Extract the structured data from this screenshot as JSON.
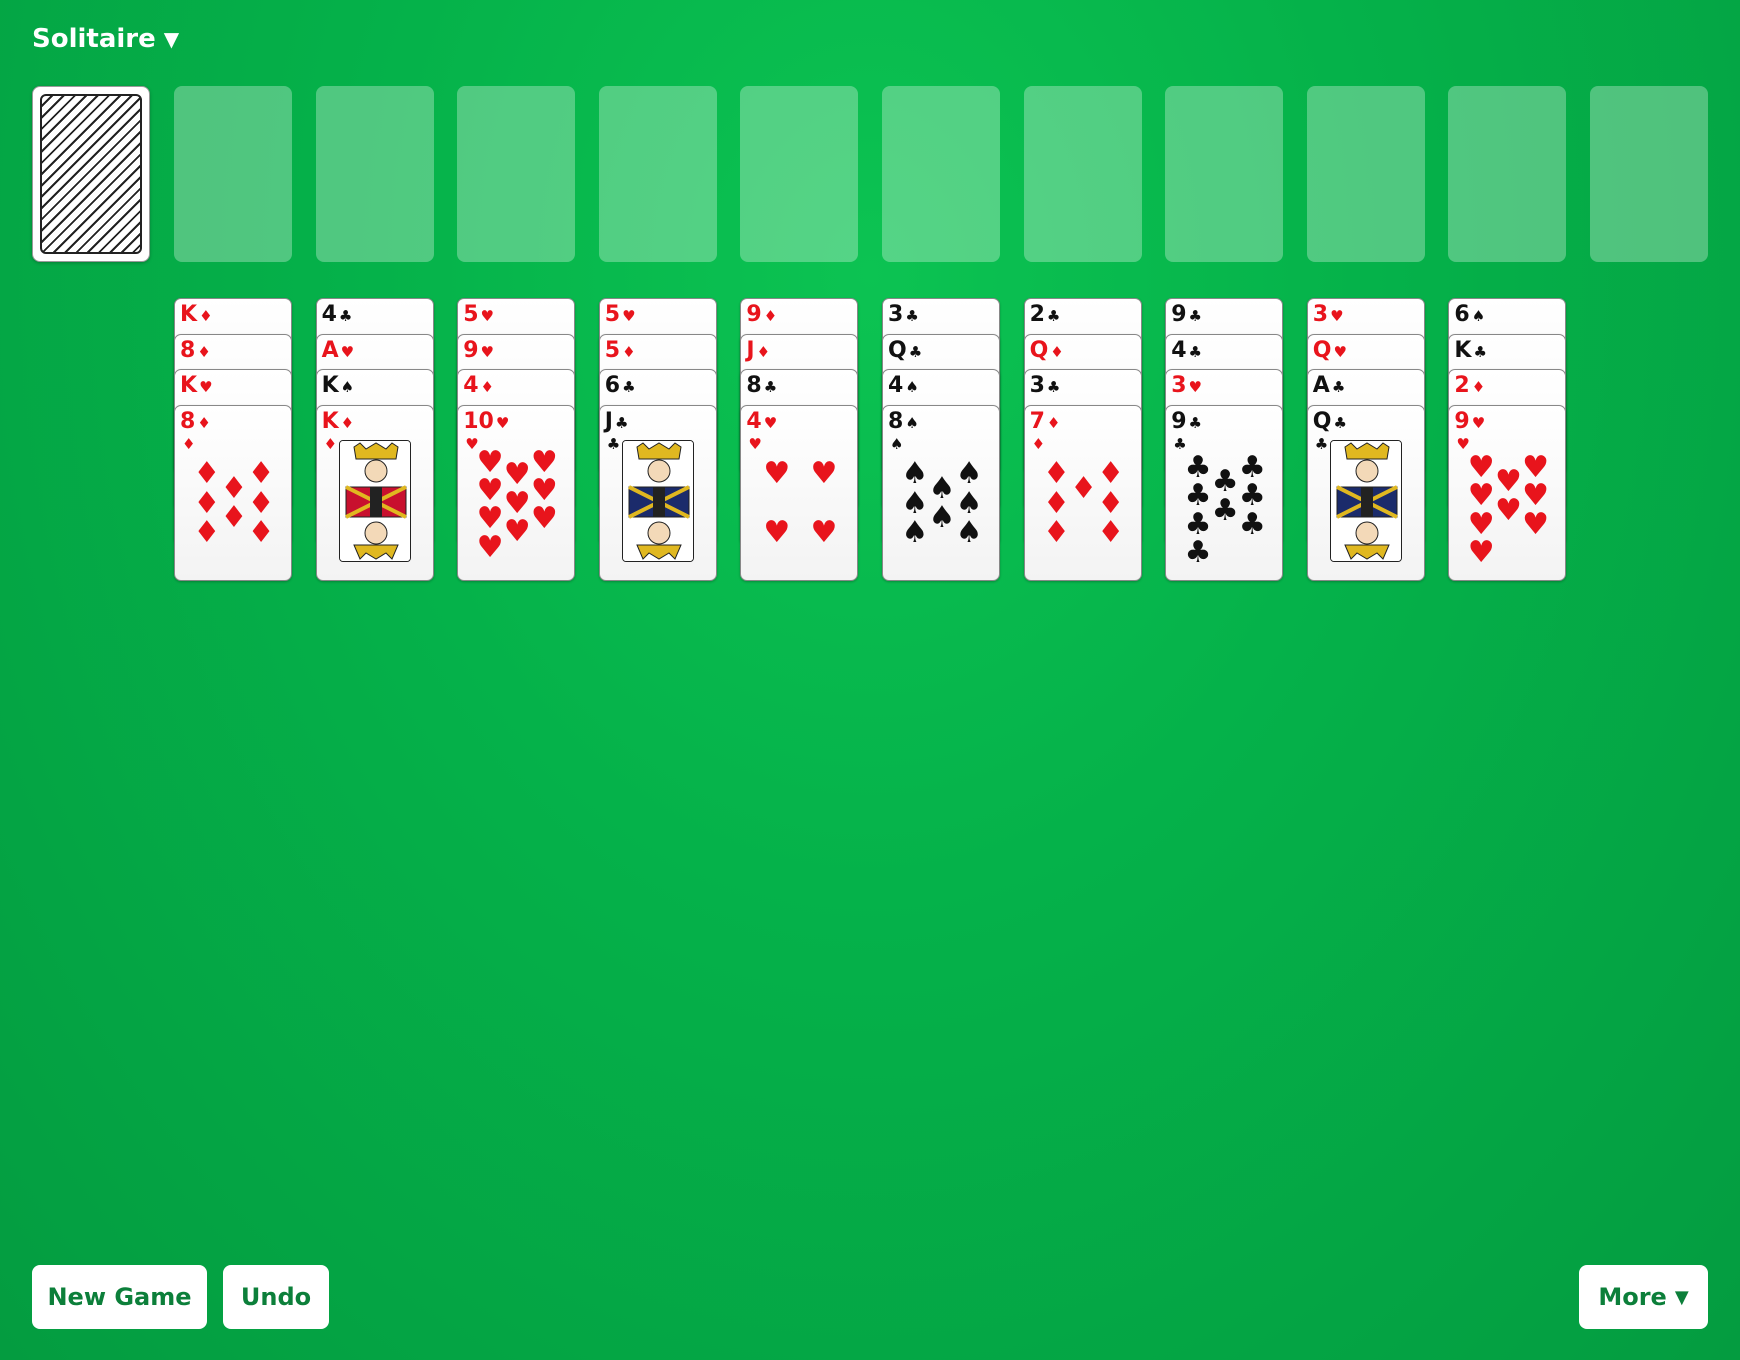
{
  "menu": {
    "title": "Solitaire",
    "arrow": "▼"
  },
  "buttons": {
    "new_game": "New Game",
    "undo": "Undo",
    "more": "More",
    "more_arrow": "▼"
  },
  "colors": {
    "felt": "#05b24a",
    "red_suit": "#e8141c",
    "black_suit": "#111111",
    "button_text": "#0c7f3a"
  },
  "foundation_slots": 11,
  "tableau": [
    {
      "cards": [
        {
          "rank": "K",
          "suit": "♦"
        },
        {
          "rank": "8",
          "suit": "♦"
        },
        {
          "rank": "K",
          "suit": "♥"
        },
        {
          "rank": "8",
          "suit": "♦"
        }
      ]
    },
    {
      "cards": [
        {
          "rank": "4",
          "suit": "♣"
        },
        {
          "rank": "A",
          "suit": "♥"
        },
        {
          "rank": "K",
          "suit": "♠"
        },
        {
          "rank": "K",
          "suit": "♦"
        }
      ]
    },
    {
      "cards": [
        {
          "rank": "5",
          "suit": "♥"
        },
        {
          "rank": "9",
          "suit": "♥"
        },
        {
          "rank": "4",
          "suit": "♦"
        },
        {
          "rank": "10",
          "suit": "♥"
        }
      ]
    },
    {
      "cards": [
        {
          "rank": "5",
          "suit": "♥"
        },
        {
          "rank": "5",
          "suit": "♦"
        },
        {
          "rank": "6",
          "suit": "♣"
        },
        {
          "rank": "J",
          "suit": "♣"
        }
      ]
    },
    {
      "cards": [
        {
          "rank": "9",
          "suit": "♦"
        },
        {
          "rank": "J",
          "suit": "♦"
        },
        {
          "rank": "8",
          "suit": "♣"
        },
        {
          "rank": "4",
          "suit": "♥"
        }
      ]
    },
    {
      "cards": [
        {
          "rank": "3",
          "suit": "♣"
        },
        {
          "rank": "Q",
          "suit": "♣"
        },
        {
          "rank": "4",
          "suit": "♠"
        },
        {
          "rank": "8",
          "suit": "♠"
        }
      ]
    },
    {
      "cards": [
        {
          "rank": "2",
          "suit": "♣"
        },
        {
          "rank": "Q",
          "suit": "♦"
        },
        {
          "rank": "3",
          "suit": "♣"
        },
        {
          "rank": "7",
          "suit": "♦"
        }
      ]
    },
    {
      "cards": [
        {
          "rank": "9",
          "suit": "♣"
        },
        {
          "rank": "4",
          "suit": "♣"
        },
        {
          "rank": "3",
          "suit": "♥"
        },
        {
          "rank": "9",
          "suit": "♣"
        }
      ]
    },
    {
      "cards": [
        {
          "rank": "3",
          "suit": "♥"
        },
        {
          "rank": "Q",
          "suit": "♥"
        },
        {
          "rank": "A",
          "suit": "♣"
        },
        {
          "rank": "Q",
          "suit": "♣"
        }
      ]
    },
    {
      "cards": [
        {
          "rank": "6",
          "suit": "♠"
        },
        {
          "rank": "K",
          "suit": "♣"
        },
        {
          "rank": "2",
          "suit": "♦"
        },
        {
          "rank": "9",
          "suit": "♥"
        }
      ]
    }
  ]
}
